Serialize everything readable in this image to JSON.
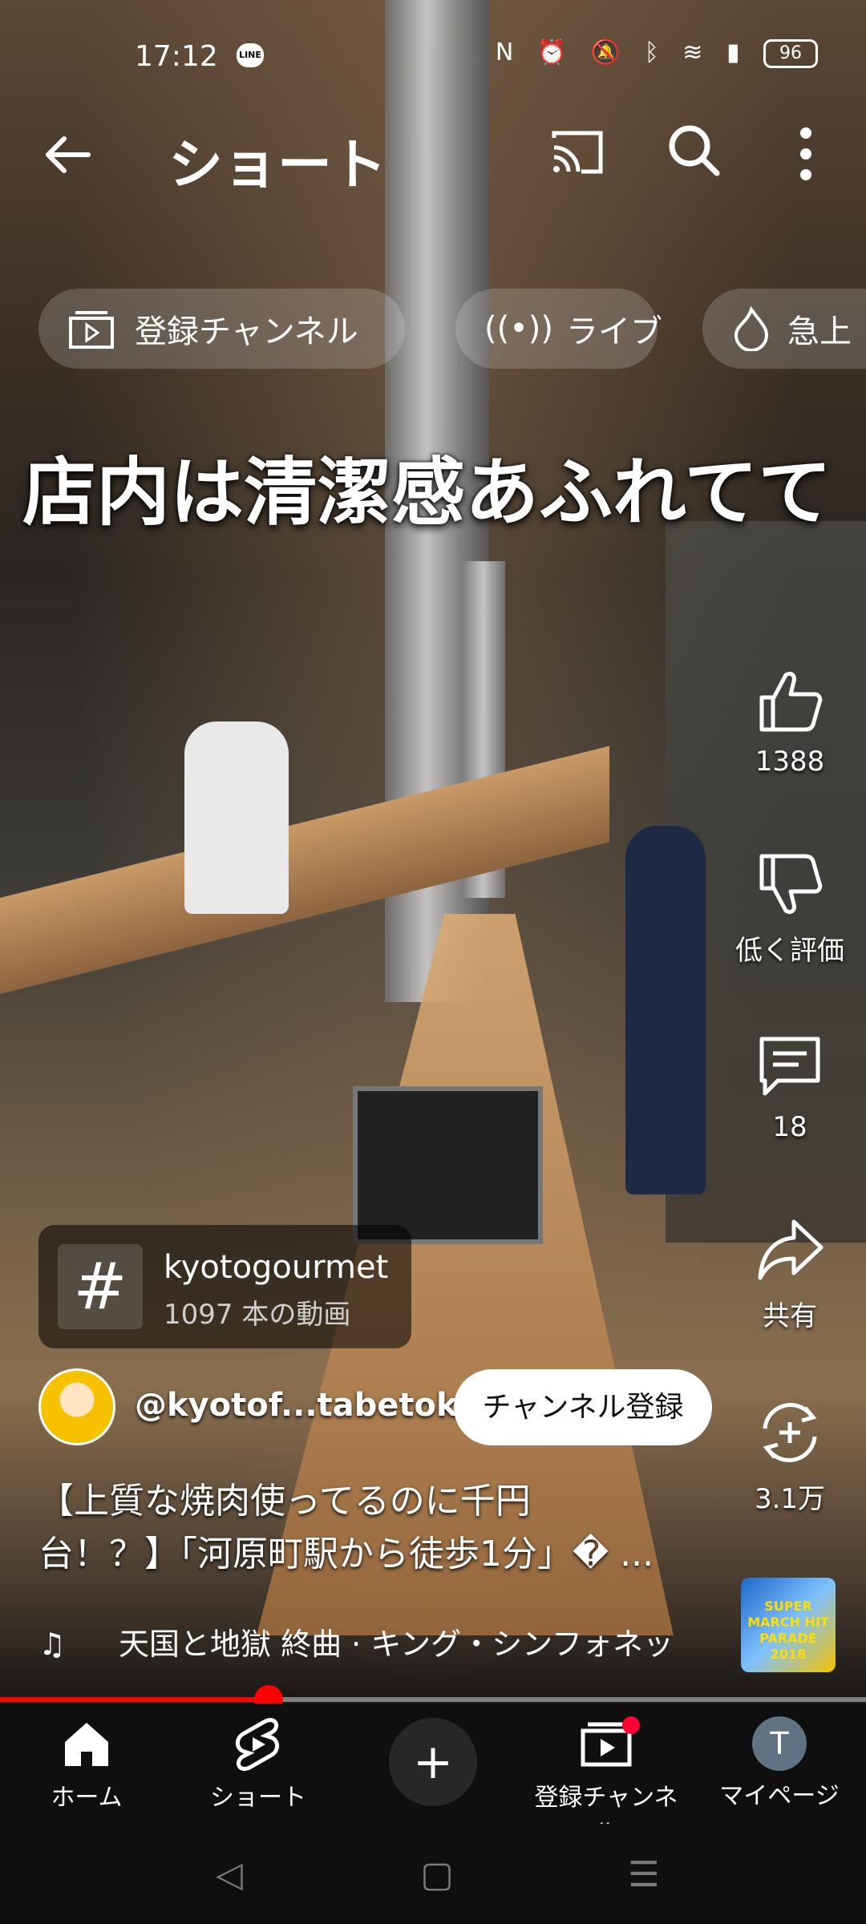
{
  "status_bar": {
    "time": "17:12",
    "line_app": "LINE",
    "battery": "96"
  },
  "top_bar": {
    "title": "ショート"
  },
  "chips": [
    {
      "label": "登録チャンネル",
      "icon": "subscriptions-icon"
    },
    {
      "label": "ライブ",
      "icon": "live-icon"
    },
    {
      "label": "急上",
      "icon": "trending-icon"
    }
  ],
  "video": {
    "caption_overlay": "店内は清潔感あふれてて",
    "progress_fraction": 0.31
  },
  "actions": {
    "likes": "1388",
    "dislike_label": "低く評価",
    "comments": "18",
    "share_label": "共有",
    "remix_count": "3.1万"
  },
  "hashtag": {
    "name": "kyotogourmet",
    "count": "1097 本の動画"
  },
  "channel": {
    "handle": "@kyotof...tabetoku",
    "subscribe_label": "チャンネル登録"
  },
  "description": {
    "line1": "【上質な焼肉使ってるのに千円",
    "line2": "台！？】「河原町駅から徒歩1分」� ..."
  },
  "music": {
    "text": "天国と地獄 終曲 · キング・シンフォネッ",
    "album_text": "SUPER MARCH HIT PARADE 2018"
  },
  "bottom_nav": {
    "home": "ホーム",
    "shorts": "ショート",
    "subscriptions": "登録チャンネル",
    "mypage": "マイページ",
    "avatar_letter": "T"
  }
}
